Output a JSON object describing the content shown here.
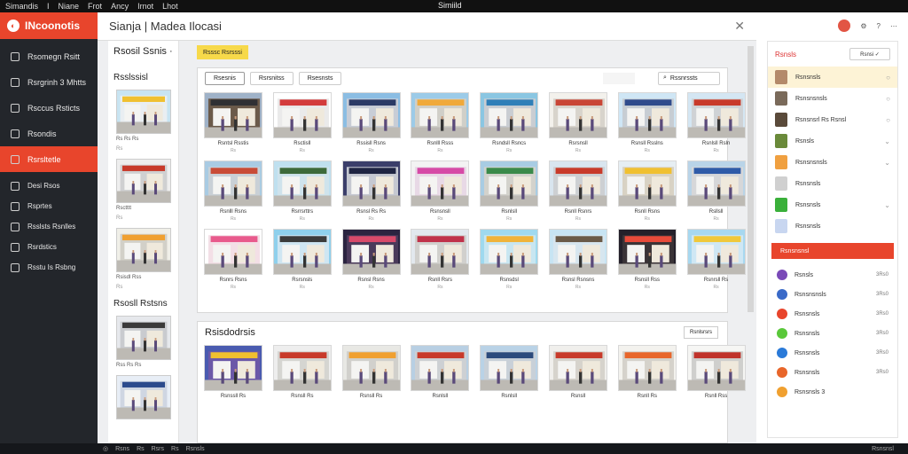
{
  "topbar": {
    "items": [
      "Simandis",
      "I",
      "Niane",
      "Frot",
      "Ancy",
      "Irnot",
      "Lhot"
    ],
    "center": "Simiild",
    "right": [
      "⬡",
      "✕",
      "◉",
      "xx"
    ]
  },
  "sidebar": {
    "brand": "INcoonotis",
    "items": [
      {
        "label": "Rsomegn Rsitt",
        "icon": "rocket-icon"
      },
      {
        "label": "Rsrgrinh 3 Mhtts",
        "icon": "pin-icon"
      },
      {
        "label": "Rsccus Rsticts",
        "icon": "grid-icon"
      },
      {
        "label": "Rsondis",
        "icon": "box-icon"
      },
      {
        "label": "Rsrsltetle",
        "icon": "folder-icon",
        "active": true
      },
      {
        "label": "Desi Rsos",
        "icon": "list-icon",
        "small": true
      },
      {
        "label": "Rsprtes",
        "icon": "copy-icon",
        "small": true
      },
      {
        "label": "Rsslsts Rsnlles",
        "icon": "chart-icon",
        "small": true
      },
      {
        "label": "Rsrdstics",
        "icon": "user-icon",
        "small": true
      },
      {
        "label": "Rsstu Is Rsbng",
        "icon": "settings-icon",
        "small": true
      }
    ]
  },
  "header": {
    "title": "Sianja | Madea Ilocasi"
  },
  "leftcol": {
    "heading": "Rsosil Ssnis ·",
    "section1": "Rsslssisl",
    "section2": "Rsosll Rstsns",
    "thumbs": [
      {
        "t": "Rs Rs Rs",
        "t2": "Rs"
      },
      {
        "t": "Rsctttt",
        "t2": "Rs"
      },
      {
        "t": "Rsisdl Rss",
        "t2": "Rs"
      },
      {
        "t": "Rss Rs Rs",
        "t2": ""
      },
      {
        "t": "",
        "t2": ""
      }
    ]
  },
  "badge": "Rsssc Rsrsssi",
  "filters": [
    {
      "label": "Rsesnis",
      "active": true
    },
    {
      "label": "Rsrsnitss"
    },
    {
      "label": "Rsesnsts"
    }
  ],
  "search": {
    "placeholder": "Rssnrssts"
  },
  "grid": [
    {
      "cap": "Rsntsl Rsstis",
      "sub": "Rs",
      "bg": "#6b5a4a",
      "sky": "#9fb2c8",
      "accent": "#2f3034"
    },
    {
      "cap": "Rsctisll",
      "sub": "Rs",
      "bg": "#eaeaea",
      "sky": "#ffffff",
      "accent": "#d33c3c"
    },
    {
      "cap": "Rssisll Rsns",
      "sub": "Rs",
      "bg": "#c8cdd6",
      "sky": "#8bbde3",
      "accent": "#2b3a66"
    },
    {
      "cap": "Rsnlll Rsss",
      "sub": "Rs",
      "bg": "#d0cfc8",
      "sky": "#9ccbe8",
      "accent": "#f0a93a"
    },
    {
      "cap": "Rsndsll Rsncs",
      "sub": "Rs",
      "bg": "#c9cdd2",
      "sky": "#8ac6e2",
      "accent": "#2f7fb8"
    },
    {
      "cap": "Rsrsnsll",
      "sub": "Rs",
      "bg": "#d8d4cc",
      "sky": "#f3f1ec",
      "accent": "#c94636"
    },
    {
      "cap": "Rsnsll Rsslns",
      "sub": "Rs",
      "bg": "#c7cdd3",
      "sky": "#cfe6f5",
      "accent": "#2f4b8c"
    },
    {
      "cap": "Rsnlsll Rsln",
      "sub": "Rs",
      "bg": "#cfd2d5",
      "sky": "#d4e6f3",
      "accent": "#c83a2a"
    },
    {
      "cap": "Rsnlll Rsns",
      "sub": "Rs",
      "bg": "#c9d0d6",
      "sky": "#a9cbe3",
      "accent": "#c94b36"
    },
    {
      "cap": "Rsrrsrttrs",
      "sub": "Rs",
      "bg": "#cfe3ec",
      "sky": "#bfe0ef",
      "accent": "#3d6a3a"
    },
    {
      "cap": "Rsnsl Rs Rs",
      "sub": "Rs",
      "bg": "#c5c8d1",
      "sky": "#3b3e6a",
      "accent": "#1f2442"
    },
    {
      "cap": "Rsnsnsll",
      "sub": "Rs",
      "bg": "#e8d9e6",
      "sky": "#f3f3f3",
      "accent": "#d64aa6"
    },
    {
      "cap": "Rsnlsll",
      "sub": "Rs",
      "bg": "#d3d2cc",
      "sky": "#a8cce3",
      "accent": "#3a8a4a"
    },
    {
      "cap": "Rsnll Rsnrs",
      "sub": "Rs",
      "bg": "#cdd0d3",
      "sky": "#d9e5ef",
      "accent": "#c83a2a"
    },
    {
      "cap": "Rsnll Rsns",
      "sub": "Rs",
      "bg": "#d8d2c4",
      "sky": "#e6eef3",
      "accent": "#f0c030"
    },
    {
      "cap": "Rsllsll",
      "sub": "Rs",
      "bg": "#d6d7d9",
      "sky": "#b9d4e8",
      "accent": "#2f5ba8"
    },
    {
      "cap": "Rsnrs Rsns",
      "sub": "Rs",
      "bg": "#f3dfe6",
      "sky": "#ffffff",
      "accent": "#e85a8c"
    },
    {
      "cap": "Rsrsnsls",
      "sub": "Rs",
      "bg": "#cfe6f2",
      "sky": "#8fd0ec",
      "accent": "#3b3b3b"
    },
    {
      "cap": "Rsnsl Rsns",
      "sub": "Rs",
      "bg": "#4a3a5a",
      "sky": "#2b2440",
      "accent": "#d84a6a"
    },
    {
      "cap": "Rsnll Rsrs",
      "sub": "Rs",
      "bg": "#d1d0cd",
      "sky": "#e2e8ee",
      "accent": "#c0324a"
    },
    {
      "cap": "Rsnsdsl",
      "sub": "Rs",
      "bg": "#c8e6f1",
      "sky": "#9fd9ef",
      "accent": "#f0b33a"
    },
    {
      "cap": "Rsnsl Rsnsns",
      "sub": "Rs",
      "bg": "#d7e6ef",
      "sky": "#c7e4f3",
      "accent": "#6a5a48"
    },
    {
      "cap": "Rsnsll Rss",
      "sub": "Rs",
      "bg": "#3a3337",
      "sky": "#24202a",
      "accent": "#e84a3a"
    },
    {
      "cap": "Rsnrsll Rs",
      "sub": "Rs",
      "bg": "#cfe7f4",
      "sky": "#a7d8f0",
      "accent": "#f0c83a"
    }
  ],
  "panel2": {
    "title": "Rsisdodrsis",
    "action": "Rsnlsrsrs",
    "cards": [
      {
        "cap": "Rsnssll Rs",
        "bg": "#6b58a8",
        "sky": "#4a5bb0",
        "accent": "#f0c030"
      },
      {
        "cap": "Rsnsll Rs",
        "bg": "#d5d5d1",
        "sky": "#eeeeee",
        "accent": "#c83a2a"
      },
      {
        "cap": "Rsnsll Rs",
        "bg": "#d1d0cc",
        "sky": "#e8e8e4",
        "accent": "#f0a030"
      },
      {
        "cap": "Rsnlsll",
        "bg": "#cdd0d3",
        "sky": "#b8cfe3",
        "accent": "#c83a2a"
      },
      {
        "cap": "Rsnlsll",
        "bg": "#c8d0d8",
        "sky": "#b9d2e6",
        "accent": "#2b4a7c"
      },
      {
        "cap": "Rsnsll",
        "bg": "#d6d3cc",
        "sky": "#f0efec",
        "accent": "#c83a2a"
      },
      {
        "cap": "Rsnll Rs",
        "bg": "#d5d2cb",
        "sky": "#f3f2ee",
        "accent": "#e8662a"
      },
      {
        "cap": "Rsnll Rss",
        "bg": "#cfcfcd",
        "sky": "#f6f6f4",
        "accent": "#c0322a"
      }
    ]
  },
  "right": {
    "header": {
      "title": "Rsnsls",
      "search": "Rsnsi ✓"
    },
    "items": [
      {
        "label": "Rsnsnsls",
        "status": "○",
        "color": "#b48a6a",
        "hi": true
      },
      {
        "label": "Rsnsnsnsls",
        "status": "○",
        "color": "#7a6a5a"
      },
      {
        "label": "Rsnsnsrl Rs Rsnsl",
        "status": "○",
        "color": "#5a4a3a"
      },
      {
        "label": "Rsnsls",
        "status": "⌄",
        "color": "#6a8a3a"
      },
      {
        "label": "Rsnsnsnsls",
        "status": "⌄",
        "color": "#f0a040"
      },
      {
        "label": "Rsnsnsls",
        "status": "",
        "color": "#d0d0d0"
      },
      {
        "label": "Rsnsnsls",
        "status": "⌄",
        "color": "#3ab03a"
      },
      {
        "label": "Rsnsnsls",
        "status": "",
        "color": "#c8d6f0"
      }
    ],
    "button": "Rsnsnsnsl",
    "list": [
      {
        "label": "Rsnsls",
        "value": "3Rs0",
        "color": "#7a4ab8"
      },
      {
        "label": "Rsnsnsnsls",
        "value": "3Rs0",
        "color": "#3a6ac8"
      },
      {
        "label": "Rsnsnsls",
        "value": "3Rs0",
        "color": "#e8452c"
      },
      {
        "label": "Rsnsnsls",
        "value": "3Rs0",
        "color": "#5ac83a"
      },
      {
        "label": "Rsnsnsls",
        "value": "3Rs0",
        "color": "#2a7ad8"
      },
      {
        "label": "Rsnsnsls",
        "value": "3Rs0",
        "color": "#e8662a"
      },
      {
        "label": "Rsnsnsls 3",
        "value": "",
        "color": "#f0a030"
      }
    ]
  },
  "bottombar": {
    "left": [
      "◎",
      "Rsns",
      "Rs",
      "Rsrs",
      "Rs",
      "Rsnsls"
    ],
    "right": "Rsnsnsl"
  }
}
